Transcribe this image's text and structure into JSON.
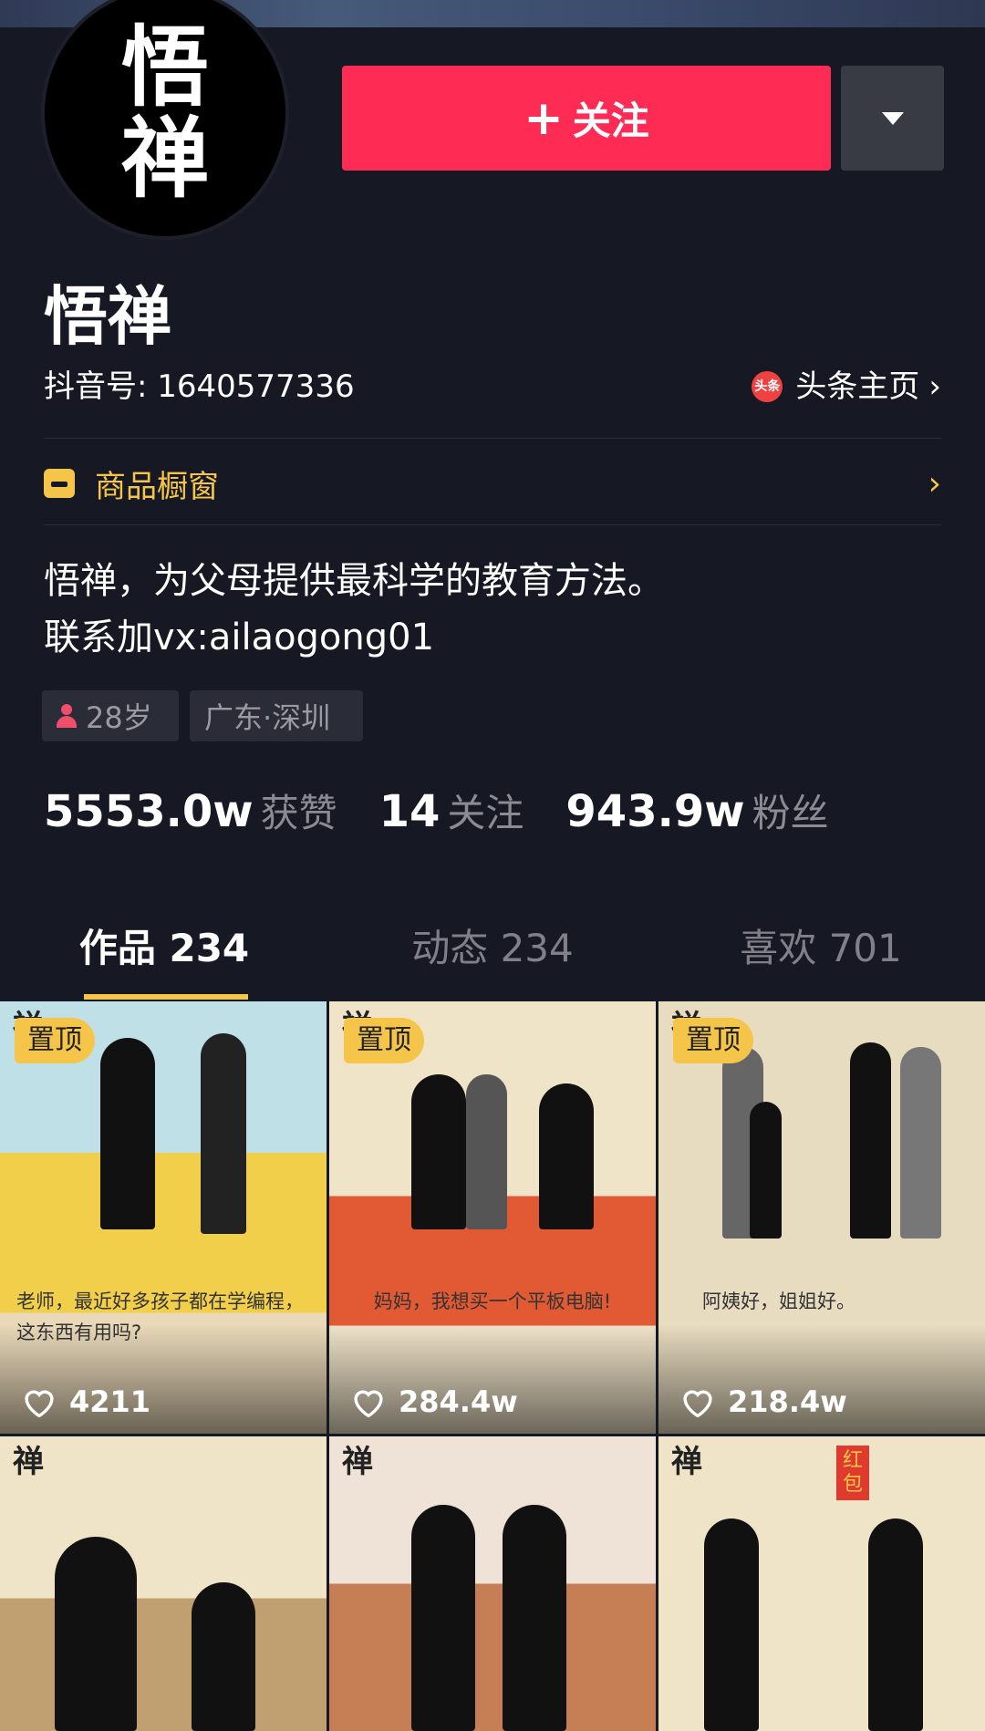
{
  "profile": {
    "avatar_text": [
      "悟",
      "禅"
    ],
    "name": "悟禅",
    "douyin_id": "抖音号: 1640577336",
    "toutiao_icon": "头条",
    "toutiao_link": "头条主页",
    "shop_label": "商品橱窗",
    "bio_line1": "悟禅，为父母提供最科学的教育方法。",
    "bio_line2": "联系加vx:ailaogong01",
    "tag_age": "28岁",
    "tag_location": "广东·深圳"
  },
  "actions": {
    "follow_plus": "+",
    "follow_label": "关注"
  },
  "stats": [
    {
      "num": "5553.0w",
      "label": "获赞"
    },
    {
      "num": "14",
      "label": "关注"
    },
    {
      "num": "943.9w",
      "label": "粉丝"
    }
  ],
  "tabs": [
    {
      "label": "作品 234",
      "active": true
    },
    {
      "label": "动态 234",
      "active": false
    },
    {
      "label": "喜欢 701",
      "active": false
    }
  ],
  "videos": [
    {
      "seal": "禅",
      "pinned": "置顶",
      "caption": "老师，最近好多孩子都在学编程，这东西有用吗?",
      "likes": "4211"
    },
    {
      "seal": "禅",
      "pinned": "置顶",
      "caption": "妈妈，我想买一个平板电脑!",
      "likes": "284.4w"
    },
    {
      "seal": "禅",
      "pinned": "置顶",
      "caption": "阿姨好，姐姐好。",
      "likes": "218.4w"
    },
    {
      "seal": "禅"
    },
    {
      "seal": "禅"
    },
    {
      "seal": "禅",
      "extra": "红包"
    }
  ],
  "icons": [
    "heart-icon",
    "dropdown-triangle-icon",
    "chevron-right-icon",
    "shop-icon",
    "person-icon"
  ],
  "colors": {
    "background": "#161823",
    "follow": "#fe2c55",
    "accent": "#f5c54a",
    "muted": "#8b8c93"
  }
}
